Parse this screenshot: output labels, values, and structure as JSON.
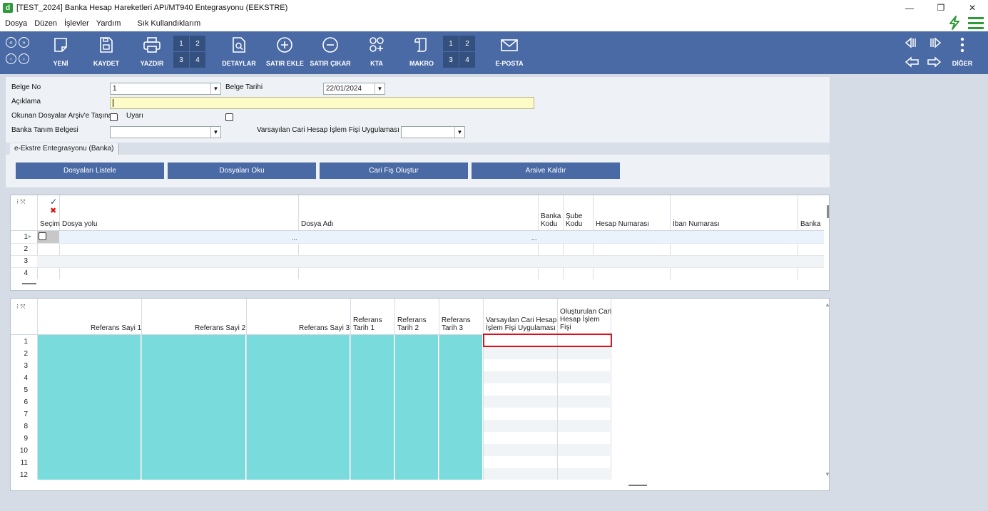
{
  "window": {
    "title": "[TEST_2024] Banka Hesap Hareketleri API/MT940 Entegrasyonu (EEKSTRE)",
    "app_icon": "d",
    "minimize": "—",
    "restore": "❐",
    "close": "✕"
  },
  "menu": {
    "items": [
      "Dosya",
      "Düzen",
      "İşlevler",
      "Yardım",
      "Sık Kullandıklarım"
    ],
    "lightning_icon": "⚡",
    "hamburger_icon": "☰",
    "accent": "#2e9a3a"
  },
  "toolbar": {
    "new": "YENİ",
    "save": "KAYDET",
    "print": "YAZDIR",
    "details": "DETAYLAR",
    "add_row": "SATIR EKLE",
    "remove_row": "SATIR ÇIKAR",
    "kta": "KTA",
    "macro": "MAKRO",
    "email": "E-POSTA",
    "more": "DİĞER",
    "grid_a": [
      "1",
      "2",
      "3",
      "4"
    ],
    "grid_b": [
      "1",
      "2",
      "3",
      "4"
    ],
    "nav": [
      "«",
      "»",
      "‹",
      "›"
    ],
    "color": "#4a6aa5"
  },
  "form": {
    "belge_no_label": "Belge No",
    "belge_no_value": "1",
    "belge_tarihi_label": "Belge Tarihi",
    "belge_tarihi_value": "22/01/2024",
    "aciklama_label": "Açıklama",
    "aciklama_value": "",
    "arsiv_label": "Okunan Dosyalar Arşiv'e Taşına",
    "uyari_label": "Uyarı",
    "banka_tanim_label": "Banka Tanım Belgesi",
    "varsayilan_label": "Varsayılan Cari Hesap İşlem Fişi Uygulaması"
  },
  "tabs": [
    "e-Ekstre Entegrasyonu (Banka)"
  ],
  "actions": [
    "Dosyaları Listele",
    "Dosyaları Oku",
    "Cari Fiş Oluştur",
    "Arsive Kaldır"
  ],
  "grid1": {
    "columns": [
      "Seçim",
      "Dosya yolu",
      "Dosya Adı",
      "Banka Kodu",
      "Şube Kodu",
      "Hesap Numarası",
      "İban Numarası",
      "Banka"
    ],
    "col_banka_kodu_lines": [
      "Banka",
      "Kodu"
    ],
    "col_sube_kodu_lines": [
      "Şube",
      "Kodu"
    ],
    "rows": [
      "1",
      "2",
      "3",
      "4"
    ],
    "ellipsis": "..."
  },
  "grid2": {
    "ref1": "Referans Sayi 1",
    "ref2": "Referans Sayi 2",
    "ref3": "Referans Sayi 3",
    "tarih1": [
      "Referans",
      "Tarih 1"
    ],
    "tarih2": [
      "Referans",
      "Tarih 2"
    ],
    "tarih3": [
      "Referans",
      "Tarih 3"
    ],
    "varsayilan": [
      "Varsayılan Cari Hesap",
      "İşlem Fişi Uygulaması"
    ],
    "olusturulan": [
      "Oluşturulan Cari",
      "Hesap İşlem",
      "Fişi"
    ],
    "rows": [
      "1",
      "2",
      "3",
      "4",
      "5",
      "6",
      "7",
      "8",
      "9",
      "10",
      "11",
      "12"
    ],
    "teal": "#79dbdb",
    "highlight": "#e0101a"
  }
}
